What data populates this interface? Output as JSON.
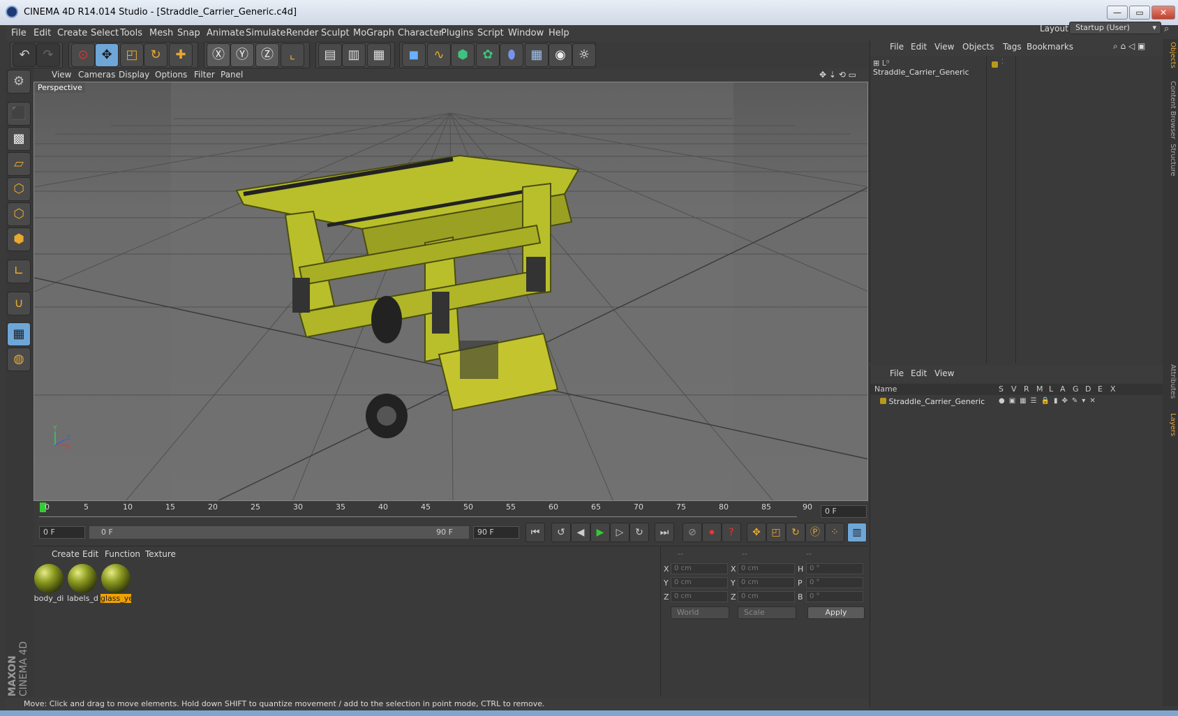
{
  "window": {
    "title": "CINEMA 4D R14.014 Studio - [Straddle_Carrier_Generic.c4d]",
    "minimize": "—",
    "maximize": "▭",
    "close": "✕"
  },
  "menubar": [
    "File",
    "Edit",
    "Create",
    "Select",
    "Tools",
    "Mesh",
    "Snap",
    "Animate",
    "Simulate",
    "Render",
    "Sculpt",
    "MoGraph",
    "Character",
    "Plugins",
    "Script",
    "Window",
    "Help"
  ],
  "layout": {
    "label": "Layout:",
    "value": "Startup (User)"
  },
  "viewport": {
    "menu": [
      "View",
      "Cameras",
      "Display",
      "Options",
      "Filter",
      "Panel"
    ],
    "label": "Perspective"
  },
  "timeline": {
    "ticks": [
      "0",
      "5",
      "10",
      "15",
      "20",
      "25",
      "30",
      "35",
      "40",
      "45",
      "50",
      "55",
      "60",
      "65",
      "70",
      "75",
      "80",
      "85",
      "90"
    ],
    "current_frame": "0 F",
    "start_field": "0 F",
    "range_start": "0 F",
    "range_end": "90 F",
    "end_field": "90 F"
  },
  "materials": {
    "menu": [
      "Create",
      "Edit",
      "Function",
      "Texture"
    ],
    "items": [
      {
        "label": "body_di",
        "selected": false
      },
      {
        "label": "labels_d",
        "selected": false
      },
      {
        "label": "glass_ye",
        "selected": true
      }
    ]
  },
  "coordinates": {
    "headers": [
      "--",
      "--",
      "--"
    ],
    "rows": [
      {
        "a": "X",
        "av": "0 cm",
        "b": "X",
        "bv": "0 cm",
        "c": "H",
        "cv": "0 °"
      },
      {
        "a": "Y",
        "av": "0 cm",
        "b": "Y",
        "bv": "0 cm",
        "c": "P",
        "cv": "0 °"
      },
      {
        "a": "Z",
        "av": "0 cm",
        "b": "Z",
        "bv": "0 cm",
        "c": "B",
        "cv": "0 °"
      }
    ],
    "world": "World",
    "scale": "Scale",
    "apply": "Apply"
  },
  "status": "Move: Click and drag to move elements. Hold down SHIFT to quantize movement / add to the selection in point mode, CTRL to remove.",
  "objects": {
    "menu": [
      "File",
      "Edit",
      "View",
      "Objects",
      "Tags",
      "Bookmarks"
    ],
    "items": [
      {
        "name": "Straddle_Carrier_Generic"
      }
    ]
  },
  "layers": {
    "menu": [
      "File",
      "Edit",
      "View"
    ],
    "columns": [
      "Name",
      "S",
      "V",
      "R",
      "M",
      "L",
      "A",
      "G",
      "D",
      "E",
      "X"
    ],
    "items": [
      {
        "name": "Straddle_Carrier_Generic"
      }
    ]
  },
  "sidetabs": [
    "Objects",
    "Content Browser",
    "Structure",
    "Attributes",
    "Layers"
  ],
  "brand": {
    "maxon": "MAXON",
    "product": "CINEMA 4D"
  },
  "colors": {
    "accent": "#f0a200",
    "model": "#b9bf2a",
    "selection": "#6ea6d8"
  }
}
